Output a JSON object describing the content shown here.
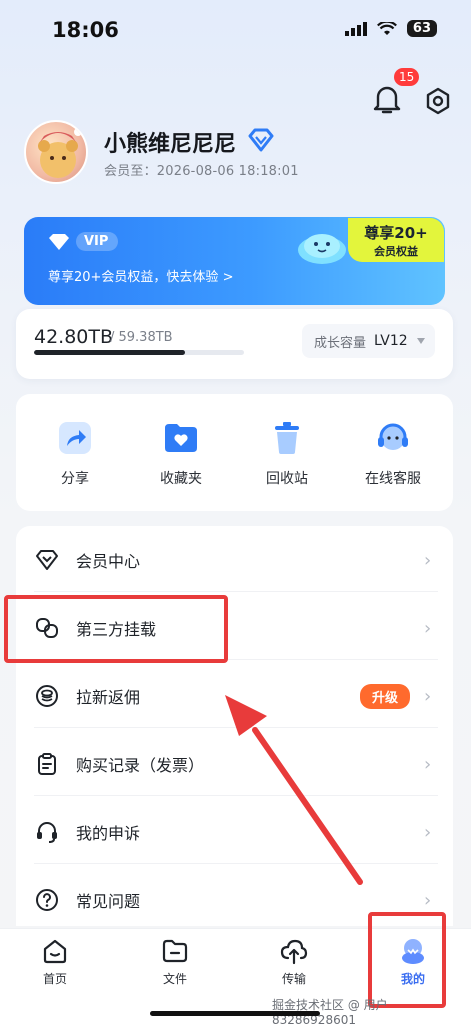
{
  "status_bar": {
    "time": "18:06",
    "battery": "63"
  },
  "header": {
    "notification_count": "15"
  },
  "profile": {
    "username": "小熊维尼尼尼",
    "member_until": "会员至：2026-08-06 18:18:01"
  },
  "vip_banner": {
    "badge": "VIP",
    "subtitle": "尊享20+会员权益，快去体验 >",
    "tag_title": "尊享20+",
    "tag_sub": "会员权益"
  },
  "storage": {
    "used": "42.80TB",
    "total": "/ 59.38TB",
    "used_fraction": 0.72,
    "growth_label": "成长容量",
    "growth_level": "LV12"
  },
  "quick_actions": [
    {
      "label": "分享",
      "icon": "share-icon"
    },
    {
      "label": "收藏夹",
      "icon": "favorites-folder-icon"
    },
    {
      "label": "回收站",
      "icon": "trash-icon"
    },
    {
      "label": "在线客服",
      "icon": "headset-icon"
    }
  ],
  "menu": [
    {
      "label": "会员中心",
      "icon": "diamond-icon"
    },
    {
      "label": "第三方挂载",
      "icon": "link-icon"
    },
    {
      "label": "拉新返佣",
      "icon": "coin-icon",
      "badge": "升级"
    },
    {
      "label": "购买记录（发票）",
      "icon": "clipboard-icon"
    },
    {
      "label": "我的申诉",
      "icon": "headphone-icon"
    },
    {
      "label": "常见问题",
      "icon": "question-icon"
    }
  ],
  "tabs": [
    {
      "label": "首页",
      "icon": "home-icon"
    },
    {
      "label": "文件",
      "icon": "folder-icon"
    },
    {
      "label": "传输",
      "icon": "cloud-upload-icon"
    },
    {
      "label": "我的",
      "icon": "profile-icon",
      "active": true
    }
  ],
  "watermark": "掘金技术社区 @ 用户83286928601",
  "colors": {
    "accent": "#3a6df0",
    "vip_gradient_start": "#2a7cf8",
    "vip_tag": "#e3f53c",
    "upgrade_badge": "#ff6a2d",
    "highlight_red": "#e83b3b"
  }
}
